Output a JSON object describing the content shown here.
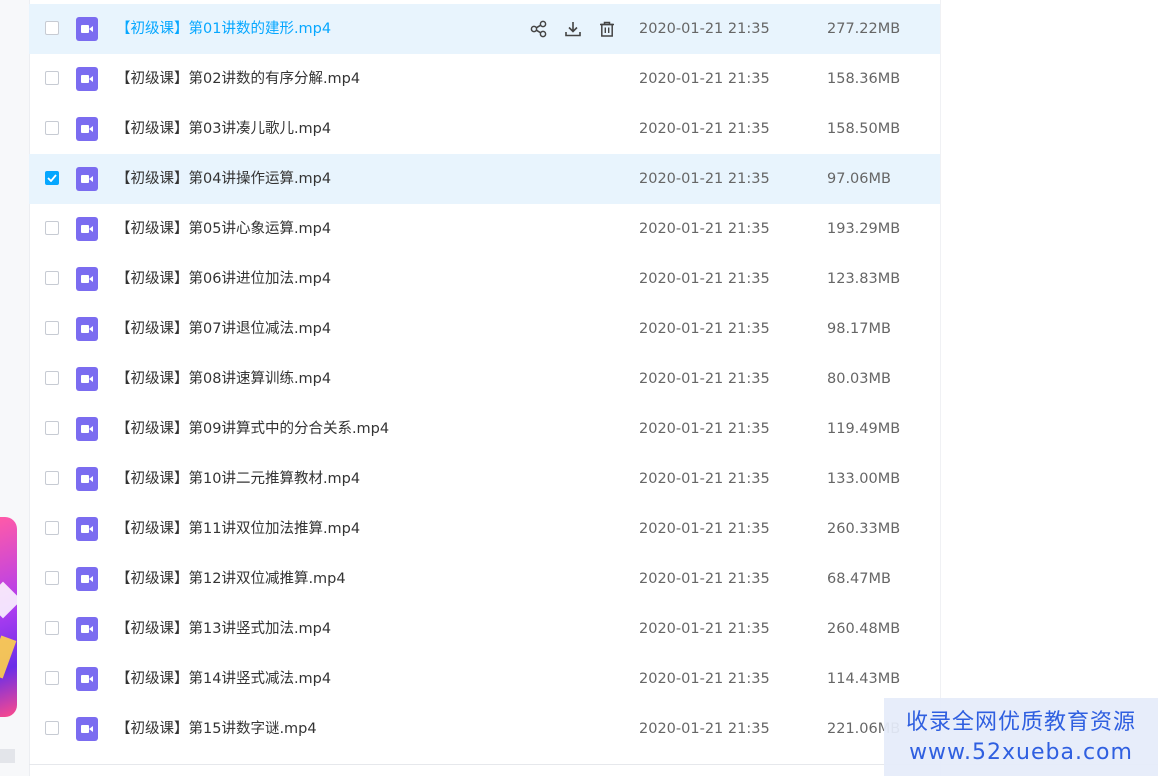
{
  "files": [
    {
      "name": "【初级课】第01讲数的建形.mp4",
      "date": "2020-01-21 21:35",
      "size": "277.22MB",
      "state": "hover"
    },
    {
      "name": "【初级课】第02讲数的有序分解.mp4",
      "date": "2020-01-21 21:35",
      "size": "158.36MB",
      "state": ""
    },
    {
      "name": "【初级课】第03讲凑儿歌儿.mp4",
      "date": "2020-01-21 21:35",
      "size": "158.50MB",
      "state": ""
    },
    {
      "name": "【初级课】第04讲操作运算.mp4",
      "date": "2020-01-21 21:35",
      "size": "97.06MB",
      "state": "selected"
    },
    {
      "name": "【初级课】第05讲心象运算.mp4",
      "date": "2020-01-21 21:35",
      "size": "193.29MB",
      "state": ""
    },
    {
      "name": "【初级课】第06讲进位加法.mp4",
      "date": "2020-01-21 21:35",
      "size": "123.83MB",
      "state": ""
    },
    {
      "name": "【初级课】第07讲退位减法.mp4",
      "date": "2020-01-21 21:35",
      "size": "98.17MB",
      "state": ""
    },
    {
      "name": "【初级课】第08讲速算训练.mp4",
      "date": "2020-01-21 21:35",
      "size": "80.03MB",
      "state": ""
    },
    {
      "name": "【初级课】第09讲算式中的分合关系.mp4",
      "date": "2020-01-21 21:35",
      "size": "119.49MB",
      "state": ""
    },
    {
      "name": "【初级课】第10讲二元推算教材.mp4",
      "date": "2020-01-21 21:35",
      "size": "133.00MB",
      "state": ""
    },
    {
      "name": "【初级课】第11讲双位加法推算.mp4",
      "date": "2020-01-21 21:35",
      "size": "260.33MB",
      "state": ""
    },
    {
      "name": "【初级课】第12讲双位减推算.mp4",
      "date": "2020-01-21 21:35",
      "size": "68.47MB",
      "state": ""
    },
    {
      "name": "【初级课】第13讲竖式加法.mp4",
      "date": "2020-01-21 21:35",
      "size": "260.48MB",
      "state": ""
    },
    {
      "name": "【初级课】第14讲竖式减法.mp4",
      "date": "2020-01-21 21:35",
      "size": "114.43MB",
      "state": ""
    },
    {
      "name": "【初级课】第15讲数字谜.mp4",
      "date": "2020-01-21 21:35",
      "size": "221.06MB",
      "state": ""
    }
  ],
  "row_actions": [
    "share-icon",
    "download-icon",
    "delete-icon"
  ],
  "watermark": {
    "line1": "收录全网优质教育资源",
    "line2": "www.52xueba.com"
  },
  "colors": {
    "accent": "#06a7ff",
    "row_highlight": "#e8f4fd",
    "video_icon": "#7b6cf0",
    "watermark_text": "#2f5fe0"
  }
}
